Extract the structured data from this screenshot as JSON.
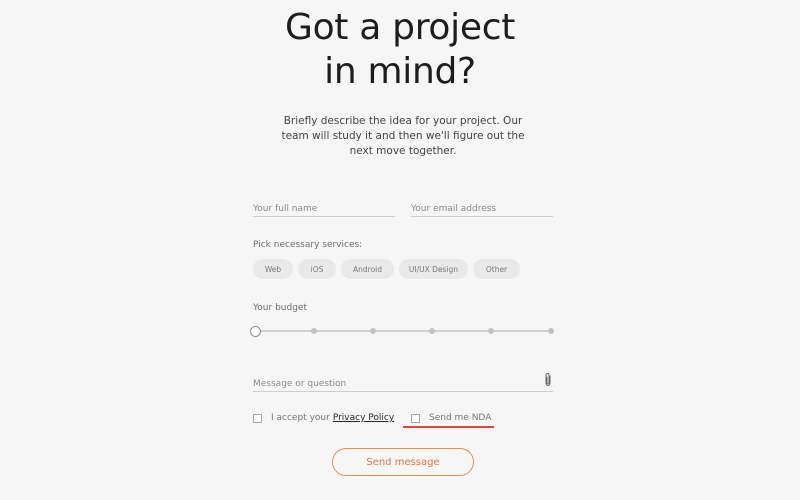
{
  "header": {
    "title_line1": "Got a project",
    "title_line2": "in mind?",
    "subtitle": "Briefly describe the idea for your project. Our team will study it and then we'll figure out the next move together."
  },
  "form": {
    "name_placeholder": "Your full name",
    "email_placeholder": "Your email address",
    "services_label": "Pick necessary services:",
    "services": [
      "Web",
      "iOS",
      "Android",
      "UI/UX Design",
      "Other"
    ],
    "budget_label": "Your budget",
    "budget_steps": 6,
    "budget_selected_step": 0,
    "message_placeholder": "Message or question",
    "attach_icon": "paperclip-icon",
    "privacy_prefix": "I accept your",
    "privacy_link": "Privacy Policy",
    "nda_label": "Send me NDA",
    "submit_label": "Send message"
  },
  "colors": {
    "background": "#f6f6f6",
    "accent": "#e8743a",
    "nda_underline": "#e0473f",
    "chip_bg": "#e9e9e9"
  }
}
